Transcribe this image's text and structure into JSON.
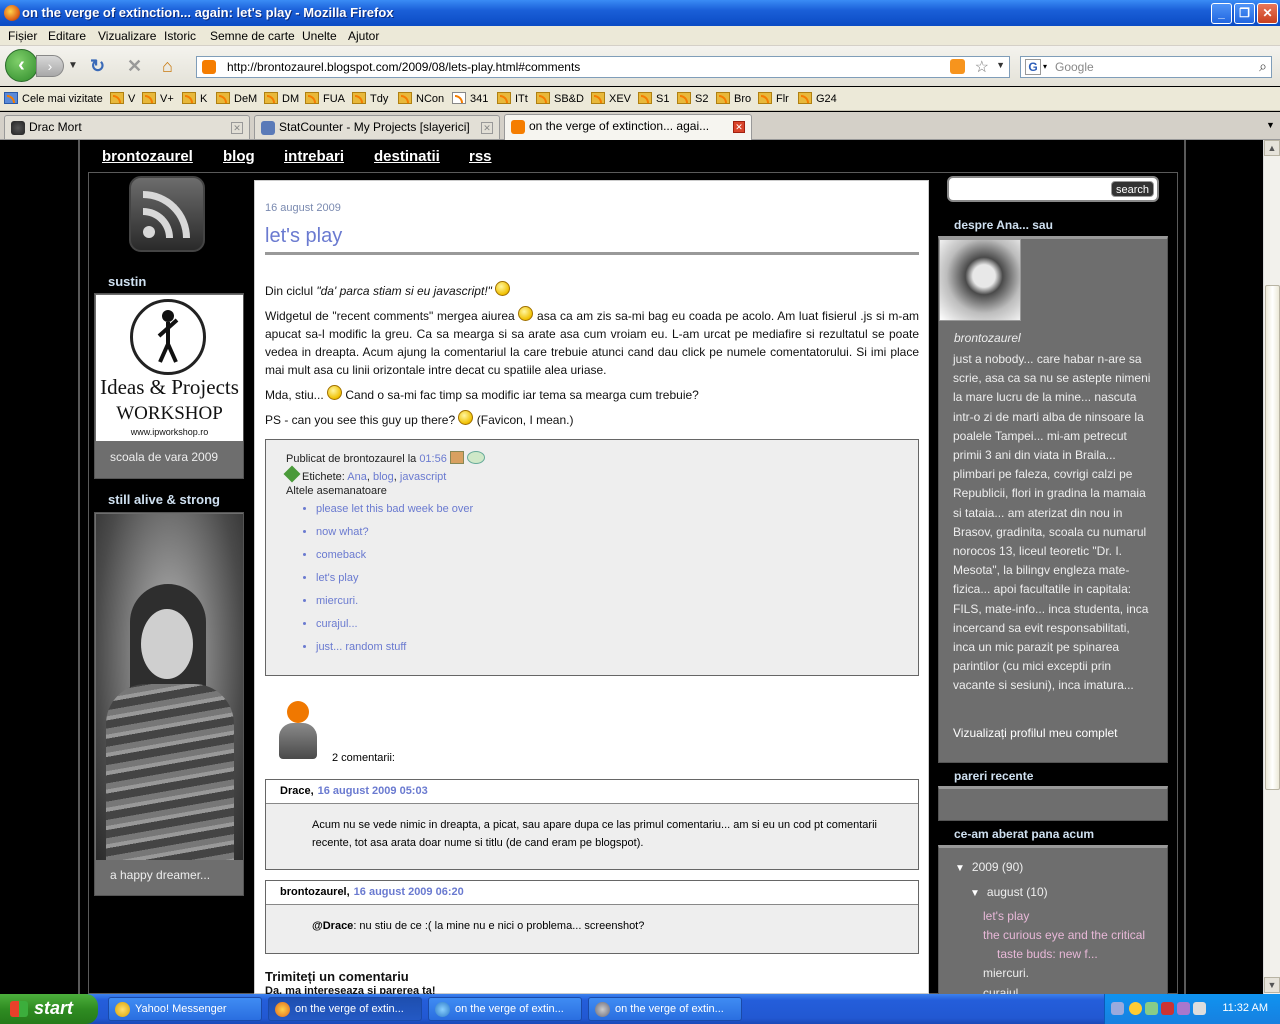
{
  "window": {
    "title": "on the verge of extinction... again: let's play - Mozilla Firefox"
  },
  "menu": [
    "Fișier",
    "Editare",
    "Vizualizare",
    "Istoric",
    "Semne de carte",
    "Unelte",
    "Ajutor"
  ],
  "nav": {
    "url": "http://brontozaurel.blogspot.com/2009/08/lets-play.html#comments",
    "search_placeholder": "Google"
  },
  "bookmarks": [
    "Cele mai vizitate",
    "V",
    "V+",
    "K",
    "DeM",
    "DM",
    "FUA",
    "Tdy",
    "NCon",
    "341",
    "ITt",
    "SB&D",
    "XEV",
    "S1",
    "S2",
    "Bro",
    "Flr",
    "G24"
  ],
  "tabs": [
    {
      "label": "Drac Mort",
      "active": false
    },
    {
      "label": "StatCounter - My Projects [slayerici]",
      "active": false
    },
    {
      "label": "on the verge of extinction... agai...",
      "active": true
    }
  ],
  "site_nav": [
    "brontozaurel",
    "blog",
    "intrebari",
    "destinatii",
    "rss"
  ],
  "left": {
    "heading1": "sustin",
    "workshop": {
      "line1": "Ideas & Projects",
      "line2": "WORKSHOP",
      "line3": "www.ipworkshop.ro"
    },
    "caption1": "scoala de vara 2009",
    "heading2": "still alive & strong",
    "caption2": "a happy dreamer..."
  },
  "post": {
    "date": "16 august 2009",
    "title": "let's play",
    "p1_prefix": "Din ciclul ",
    "p1_quote": "\"da' parca stiam si eu javascript!\"",
    "p2_a": "Widgetul de \"recent comments\" mergea aiurea ",
    "p2_b": " asa ca am zis sa-mi bag eu coada pe acolo. Am luat fisierul .js si m-am apucat sa-l modific la greu. Ca sa mearga si sa arate asa cum vroiam eu. L-am urcat pe mediafire si rezultatul se poate vedea in dreapta. Acum ajung la comentariul la care trebuie atunci cand dau click pe numele comentatorului. Si imi place mai mult asa cu linii orizontale intre decat cu spatiile alea uriase.",
    "p3_a": "Mda, stiu... ",
    "p3_b": " Cand o sa-mi fac timp sa modific iar tema sa mearga cum trebuie?",
    "p4_a": "PS - can you see this guy up there? ",
    "p4_b": " (Favicon, I mean.)",
    "published_prefix": "Publicat de brontozaurel la ",
    "published_time": "01:56",
    "labels_prefix": "Etichete: ",
    "labels": [
      "Ana",
      "blog",
      "javascript"
    ],
    "related_title": "Altele asemanatoare",
    "related": [
      "please let this bad week be over",
      "now what?",
      "comeback",
      "let's play",
      "miercuri.",
      "curajul...",
      "just... random stuff"
    ],
    "comment_count": "2 comentarii:",
    "comments": [
      {
        "author": "Drace,",
        "date": "16 august 2009 05:03",
        "text": "Acum nu se vede nimic in dreapta, a picat, sau apare dupa ce las primul comentariu... am si eu un cod pt comentarii recente, tot asa arata doar nume si titlu (de cand eram pe blogspot)."
      },
      {
        "author": "brontozaurel,",
        "date": "16 august 2009 06:20",
        "mention": "@Drace",
        "text": ": nu stiu de ce :( la mine nu e nici o problema... screenshot?"
      }
    ],
    "send_title": "Trimiteți un comentariu",
    "send_sub": "Da, ma intereseaza si parerea ta!"
  },
  "right": {
    "search_button": "search",
    "profile_heading": "despre Ana... sau",
    "profile_name": "brontozaurel",
    "profile_desc": "just a nobody... care habar n-are sa scrie, asa ca sa nu se astepte nimeni la mare lucru de la mine... nascuta intr-o zi de marti alba de ninsoare la poalele Tampei... mi-am petrecut primii 3 ani din viata in Braila... plimbari pe faleza, covrigi calzi pe Republicii, flori in gradina la mamaia si tataia... am aterizat din nou in Brasov, gradinita, scoala cu numarul norocos 13, liceul teoretic \"Dr. I. Mesota\", la bilingv engleza mate-fizica... apoi facultatile in capitala: FILS, mate-info... inca studenta, inca incercand sa evit responsabilitati, inca un mic parazit pe spinarea parintilor (cu mici exceptii prin vacante si sesiuni), inca imatura...",
    "profile_link": "Vizualizați profilul meu complet",
    "recent_heading": "pareri recente",
    "archive_heading": "ce-am aberat pana acum",
    "archive": {
      "year": "2009 (90)",
      "month": "august (10)",
      "posts": [
        "let's play",
        "the curious eye and the critical",
        "taste buds: new f...",
        "miercuri.",
        "curajul"
      ]
    }
  },
  "taskbar": {
    "start": "start",
    "items": [
      "Yahoo! Messenger",
      "on the verge of extin...",
      "on the verge of extin...",
      "on the verge of extin..."
    ],
    "clock": "11:32 AM"
  }
}
